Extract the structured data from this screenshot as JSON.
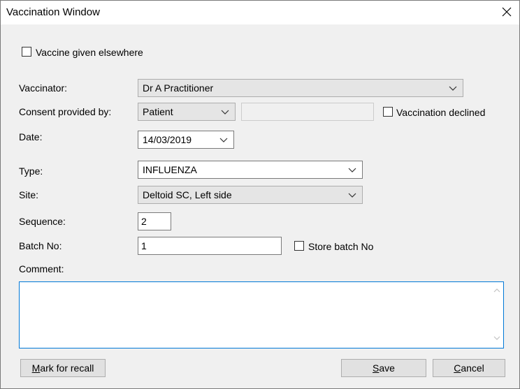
{
  "window": {
    "title": "Vaccination Window"
  },
  "form": {
    "given_elsewhere_label": "Vaccine given elsewhere",
    "vaccinator": {
      "label": "Vaccinator:",
      "value": "Dr A Practitioner"
    },
    "consent": {
      "label": "Consent provided by:",
      "value": "Patient",
      "other": ""
    },
    "declined_label": "Vaccination declined",
    "date": {
      "label": "Date:",
      "value": "14/03/2019"
    },
    "type": {
      "label": "Type:",
      "value": "INFLUENZA"
    },
    "site": {
      "label": "Site:",
      "value": "Deltoid SC, Left side"
    },
    "sequence": {
      "label": "Sequence:",
      "value": "2"
    },
    "batch": {
      "label": "Batch No:",
      "value": "1",
      "store_label": "Store batch No"
    },
    "comment": {
      "label": "Comment:",
      "value": ""
    }
  },
  "buttons": {
    "recall_mnemonic": "M",
    "recall_rest": "ark for recall",
    "save_mnemonic": "S",
    "save_rest": "ave",
    "cancel_mnemonic": "C",
    "cancel_rest": "ancel"
  }
}
